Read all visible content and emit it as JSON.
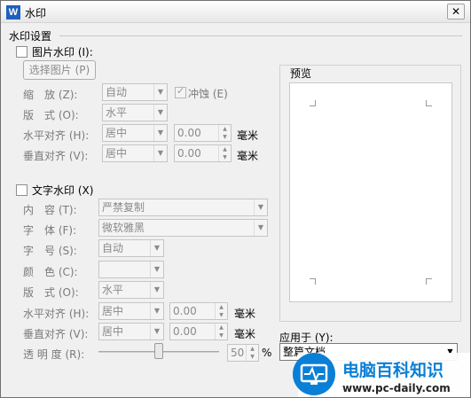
{
  "window": {
    "title": "水印",
    "app_icon_letter": "W",
    "close_glyph": "✕"
  },
  "watermark_settings": {
    "group_label": "水印设置"
  },
  "picture_watermark": {
    "checkbox_label": "图片水印 (I):",
    "select_picture_button": "选择图片 (P)",
    "scale_label": "缩　放 (Z):",
    "scale_value": "自动",
    "washout_label": "冲蚀 (E)",
    "layout_label": "版　式 (O):",
    "layout_value": "水平",
    "h_align_label": "水平对齐 (H):",
    "h_align_value": "居中",
    "h_offset_value": "0.00",
    "h_unit": "毫米",
    "v_align_label": "垂直对齐 (V):",
    "v_align_value": "居中",
    "v_offset_value": "0.00",
    "v_unit": "毫米"
  },
  "text_watermark": {
    "checkbox_label": "文字水印 (X)",
    "content_label": "内　容 (T):",
    "content_value": "严禁复制",
    "font_label": "字　体 (F):",
    "font_value": "微软雅黑",
    "size_label": "字　号 (S):",
    "size_value": "自动",
    "color_label": "颜　色 (C):",
    "color_value": "",
    "layout_label": "版　式 (O):",
    "layout_value": "水平",
    "h_align_label": "水平对齐 (H):",
    "h_align_value": "居中",
    "h_offset_value": "0.00",
    "h_unit": "毫米",
    "v_align_label": "垂直对齐 (V):",
    "v_align_value": "居中",
    "v_offset_value": "0.00",
    "v_unit": "毫米",
    "transparency_label": "透 明 度 (R):",
    "transparency_value": "50",
    "transparency_unit": "%",
    "transparency_fraction": 0.5
  },
  "preview": {
    "label": "预览"
  },
  "apply_to": {
    "label": "应用于 (Y):",
    "value": "整篇文档"
  },
  "brand_overlay": {
    "title": "电脑百科知识",
    "url": "www.pc-daily.com",
    "accent": "#0a7fd6"
  }
}
